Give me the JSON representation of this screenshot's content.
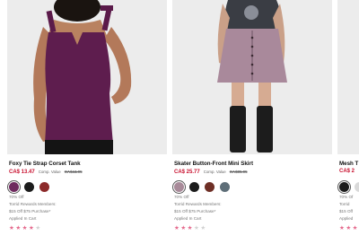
{
  "products": [
    {
      "title": "Foxy Tie Strap Corset Tank",
      "price": "CA$ 13.47",
      "comp_label": "Comp. Value",
      "comp_value": "CA$44.95",
      "swatches": [
        {
          "color": "#6e2a5e",
          "selected": true
        },
        {
          "color": "#1c1c1c",
          "selected": false
        },
        {
          "color": "#8c2a2a",
          "selected": false
        }
      ],
      "promo_lines": [
        "70% Off",
        "Torrid Rewards Members:",
        "$15 Off $75 Purchase*",
        "Applied In Cart"
      ],
      "rating": 4,
      "rating_max": 5
    },
    {
      "title": "Skater Button-Front Mini Skirt",
      "price": "CA$ 25.77",
      "comp_label": "Comp. Value",
      "comp_value": "CA$85.95",
      "swatches": [
        {
          "color": "#a88a99",
          "selected": true
        },
        {
          "color": "#1c1c1c",
          "selected": false
        },
        {
          "color": "#6e2f26",
          "selected": false
        },
        {
          "color": "#5e6e78",
          "selected": false
        }
      ],
      "promo_lines": [
        "70% Off",
        "Torrid Rewards Members:",
        "$15 Off $75 Purchase*",
        "Applied In Cart"
      ],
      "rating": 3,
      "rating_max": 5
    },
    {
      "title": "Mesh T",
      "price": "CA$ 2",
      "comp_label": "",
      "comp_value": "",
      "swatches": [
        {
          "color": "#1c1c1c",
          "selected": true
        },
        {
          "color": "#d9d9d9",
          "selected": false
        }
      ],
      "promo_lines": [
        "70% Of",
        "Torrid",
        "$15 Off",
        "Applied"
      ],
      "rating": 4,
      "rating_max": 5
    }
  ]
}
